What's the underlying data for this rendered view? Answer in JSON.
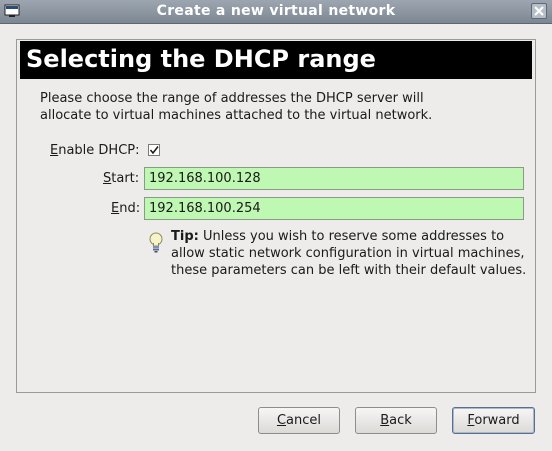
{
  "window": {
    "title": "Create a new virtual network"
  },
  "page": {
    "heading": "Selecting the DHCP range",
    "description_line1": "Please choose the range of addresses the DHCP server will",
    "description_line2": "allocate to virtual machines attached to the virtual network."
  },
  "dhcp": {
    "enable_label_mnemonic": "E",
    "enable_label_rest": "nable DHCP:",
    "enabled": true,
    "start_label_mnemonic": "S",
    "start_label_rest": "tart:",
    "start_value": "192.168.100.128",
    "end_label_mnemonic": "E",
    "end_label_rest": "nd:",
    "end_value": "192.168.100.254"
  },
  "tip": {
    "prefix": "Tip:",
    "line1": " Unless you wish to reserve some addresses to",
    "line2": "allow static network configuration in virtual machines,",
    "line3": "these parameters can be left with their default values."
  },
  "buttons": {
    "cancel_mnemonic": "C",
    "cancel_rest": "ancel",
    "back_mnemonic": "B",
    "back_rest": "ack",
    "forward_mnemonic": "F",
    "forward_rest": "orward"
  },
  "icons": {
    "window": "app-window-icon",
    "close": "close-icon",
    "tip": "lightbulb-icon",
    "check": "checkmark-icon"
  }
}
